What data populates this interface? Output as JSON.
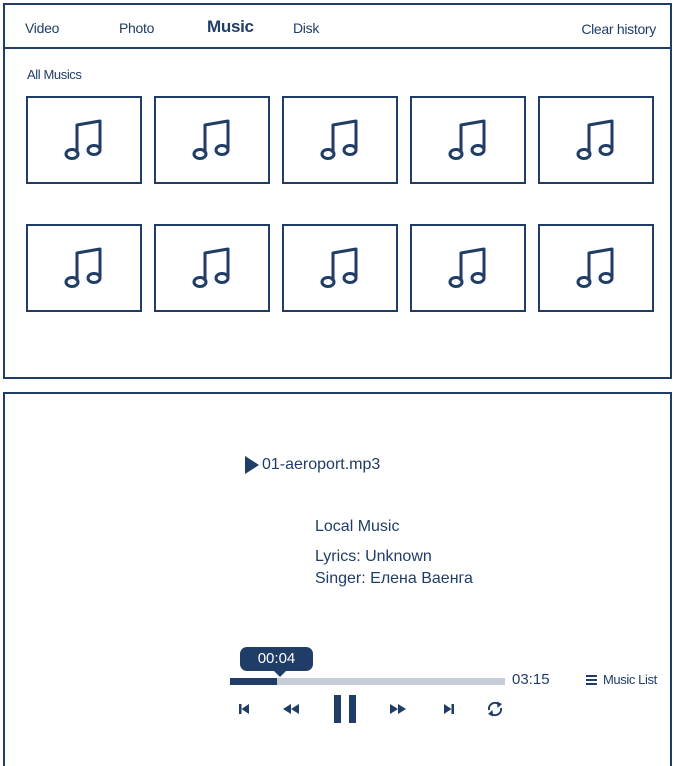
{
  "tabs": [
    {
      "label": "Video",
      "active": false
    },
    {
      "label": "Photo",
      "active": false
    },
    {
      "label": "Music",
      "active": true
    },
    {
      "label": "Disk",
      "active": false
    }
  ],
  "clear_history_label": "Clear history",
  "section_title": "All Musics",
  "tile_icon": "music-note-icon",
  "tile_count": 10,
  "player": {
    "track_title": "01-aeroport.mp3",
    "source": "Local Music",
    "lyrics": "Lyrics: Unknown",
    "singer": "Singer: Елена Ваенга",
    "current_time": "00:04",
    "total_time": "03:15",
    "progress_fraction": 0.17,
    "music_list_label": "Music List",
    "controls": [
      "previous-track-icon",
      "rewind-icon",
      "pause-icon",
      "fast-forward-icon",
      "next-track-icon",
      "repeat-icon"
    ]
  },
  "colors": {
    "accent": "#1f3d66",
    "track": "#c7cdd6"
  }
}
